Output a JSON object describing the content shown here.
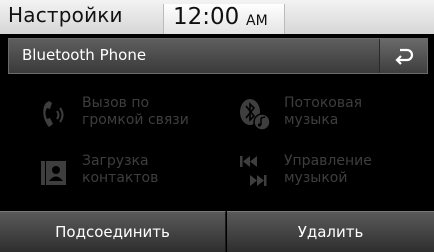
{
  "status": {
    "title": "Настройки",
    "time": "12:00",
    "ampm": "AM"
  },
  "header": {
    "title": "Bluetooth Phone",
    "back_icon": "back-arrow-icon"
  },
  "menu": {
    "speakerphone": {
      "line1": "Вызов по",
      "line2": "громкой связи",
      "icon": "phone-speaker-icon"
    },
    "streaming": {
      "line1": "Потоковая",
      "line2": "музыка",
      "icon": "bluetooth-music-icon"
    },
    "contacts": {
      "line1": "Загрузка",
      "line2": "контактов",
      "icon": "contacts-download-icon"
    },
    "music_control": {
      "line1": "Управление",
      "line2": "музыкой",
      "icon": "prev-next-track-icon"
    }
  },
  "buttons": {
    "connect": "Подсоединить",
    "delete": "Удалить"
  },
  "colors": {
    "disabled_text": "#3e3e3e",
    "background": "#000000"
  }
}
